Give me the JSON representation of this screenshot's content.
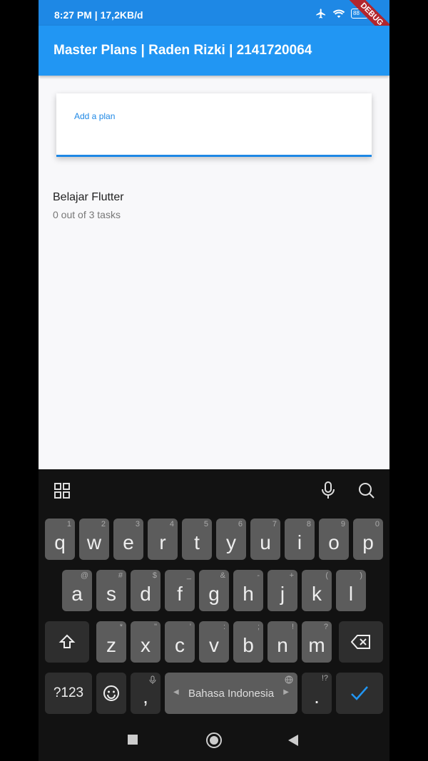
{
  "status": {
    "time": "8:27 PM | 17,2KB/d",
    "battery": "88",
    "debug_banner": "DEBUG",
    "colors": {
      "bar": "#1e88e5",
      "banner": "#b3262d"
    }
  },
  "app_bar": {
    "title": "Master Plans | Raden Rizki | 2141720064",
    "color": "#2196f3"
  },
  "plan_input": {
    "label": "Add a plan"
  },
  "plans": [
    {
      "title": "Belajar Flutter",
      "subtitle": "0 out of 3 tasks"
    }
  ],
  "keyboard": {
    "row1": [
      {
        "k": "q",
        "h": "1"
      },
      {
        "k": "w",
        "h": "2"
      },
      {
        "k": "e",
        "h": "3"
      },
      {
        "k": "r",
        "h": "4"
      },
      {
        "k": "t",
        "h": "5"
      },
      {
        "k": "y",
        "h": "6"
      },
      {
        "k": "u",
        "h": "7"
      },
      {
        "k": "i",
        "h": "8"
      },
      {
        "k": "o",
        "h": "9"
      },
      {
        "k": "p",
        "h": "0"
      }
    ],
    "row2": [
      {
        "k": "a",
        "h": "@"
      },
      {
        "k": "s",
        "h": "#"
      },
      {
        "k": "d",
        "h": "$"
      },
      {
        "k": "f",
        "h": "_"
      },
      {
        "k": "g",
        "h": "&"
      },
      {
        "k": "h",
        "h": "-"
      },
      {
        "k": "j",
        "h": "+"
      },
      {
        "k": "k",
        "h": "("
      },
      {
        "k": "l",
        "h": ")"
      }
    ],
    "row3": [
      {
        "k": "z",
        "h": "*"
      },
      {
        "k": "x",
        "h": "\""
      },
      {
        "k": "c",
        "h": "'"
      },
      {
        "k": "v",
        "h": ":"
      },
      {
        "k": "b",
        "h": ";"
      },
      {
        "k": "n",
        "h": "!"
      },
      {
        "k": "m",
        "h": "?"
      }
    ],
    "symbols_label": "?123",
    "comma": ",",
    "period": ".",
    "period_hint": "!?",
    "space_label": "Bahasa Indonesia",
    "accent_color": "#2196f3"
  },
  "icons": [
    "apps-grid-icon",
    "mic-icon",
    "search-icon",
    "shift-icon",
    "backspace-icon",
    "emoji-icon",
    "check-icon",
    "nav-recents-icon",
    "nav-home-icon",
    "nav-back-icon"
  ]
}
